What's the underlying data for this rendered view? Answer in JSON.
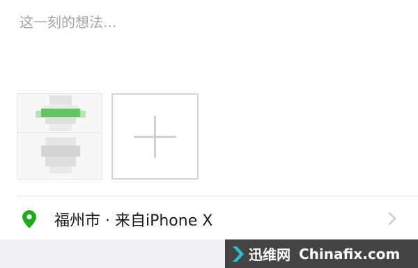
{
  "composer": {
    "placeholder": "这一刻的想法...",
    "text_value": ""
  },
  "photos": {
    "attached_count": 1,
    "add_icon": "plus-icon"
  },
  "location": {
    "text": "福州市 · 来自iPhone X",
    "icon": "location-pin-icon",
    "chevron_icon": "chevron-right-icon",
    "pin_color": "#1aad19"
  },
  "watermark": {
    "brand_cn": "迅维网",
    "brand_en": "Chinafix.com"
  }
}
